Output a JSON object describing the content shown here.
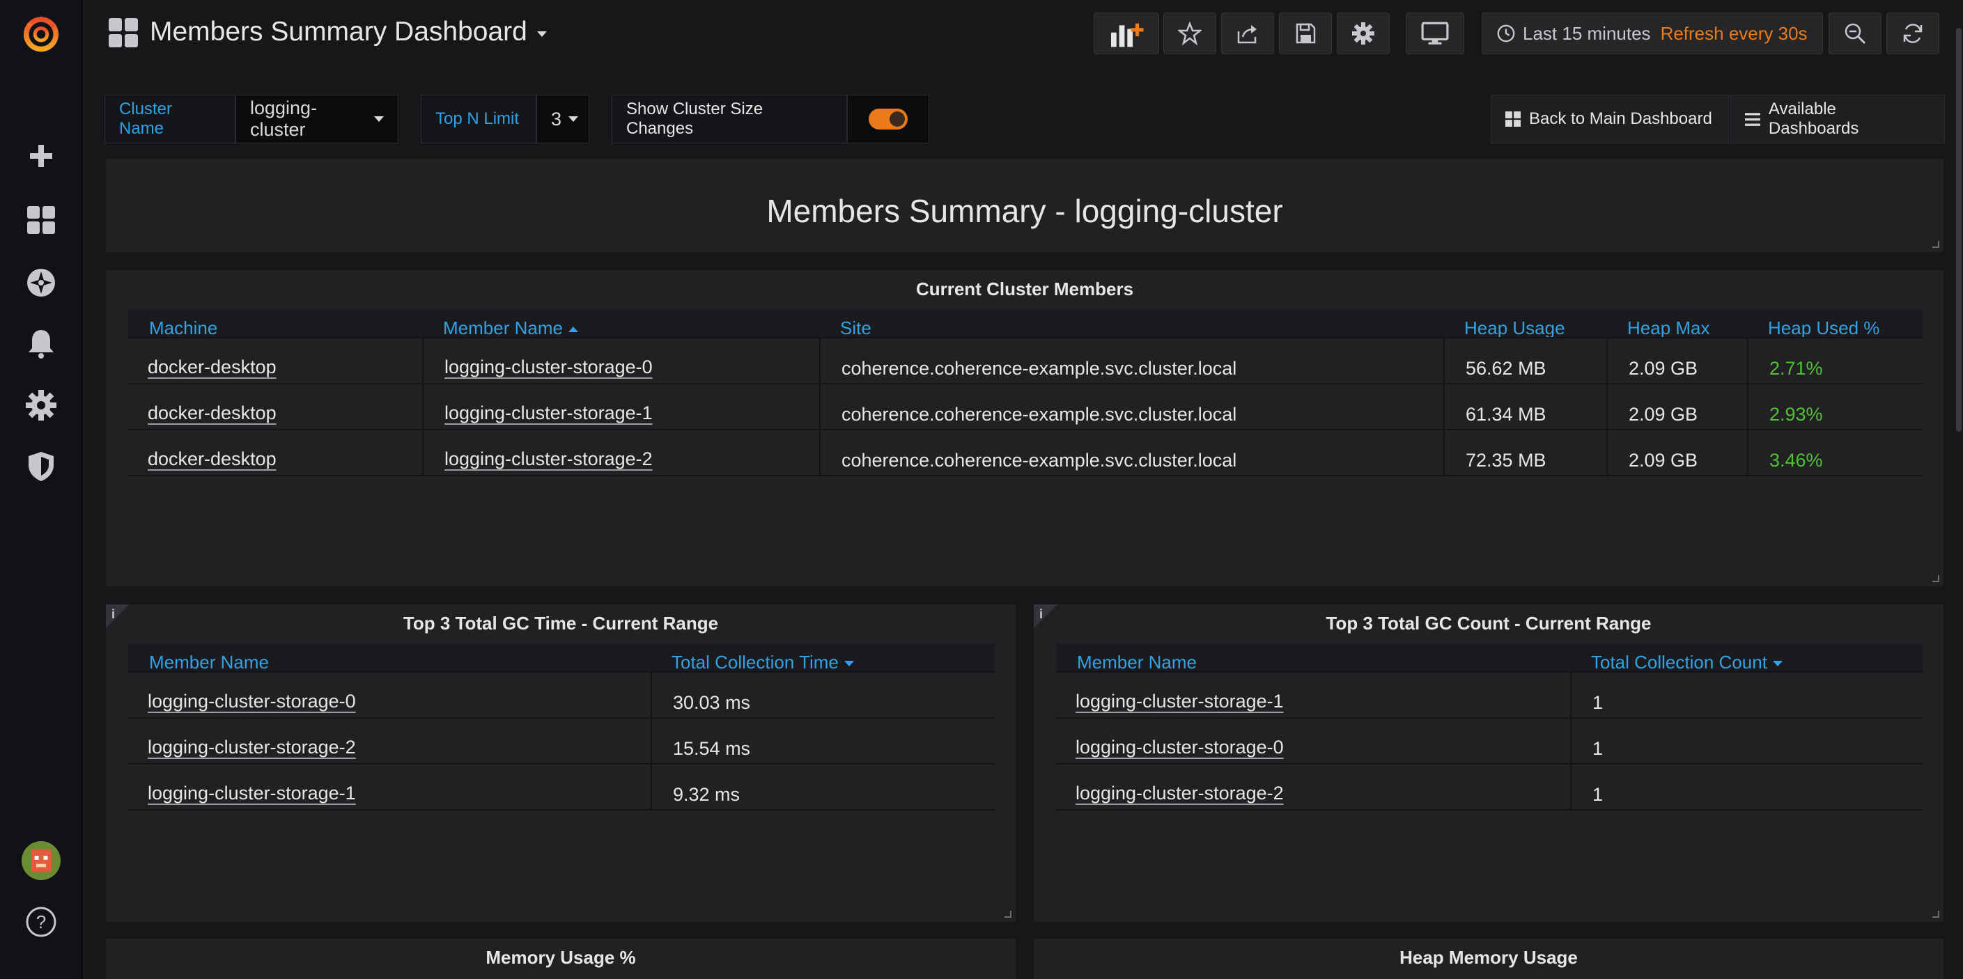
{
  "dashboard": {
    "title": "Members Summary Dashboard"
  },
  "toolbar": {
    "time_range": "Last 15 minutes",
    "refresh": "Refresh every 30s"
  },
  "variables": {
    "cluster_label": "Cluster Name",
    "cluster_value": "logging-cluster",
    "topn_label": "Top N Limit",
    "topn_value": "3",
    "size_changes_label": "Show Cluster Size Changes",
    "size_changes_enabled": true
  },
  "links": {
    "back": "Back to Main Dashboard",
    "available": "Available Dashboards"
  },
  "text_panel": {
    "title": "Members Summary - logging-cluster"
  },
  "members_panel": {
    "title": "Current Cluster Members",
    "columns": [
      "Machine",
      "Member Name",
      "Site",
      "Heap Usage",
      "Heap Max",
      "Heap Used %"
    ],
    "rows": [
      [
        "docker-desktop",
        "logging-cluster-storage-0",
        "coherence.coherence-example.svc.cluster.local",
        "56.62 MB",
        "2.09 GB",
        "2.71%"
      ],
      [
        "docker-desktop",
        "logging-cluster-storage-1",
        "coherence.coherence-example.svc.cluster.local",
        "61.34 MB",
        "2.09 GB",
        "2.93%"
      ],
      [
        "docker-desktop",
        "logging-cluster-storage-2",
        "coherence.coherence-example.svc.cluster.local",
        "72.35 MB",
        "2.09 GB",
        "3.46%"
      ]
    ]
  },
  "gc_time_panel": {
    "info": "i",
    "title": "Top 3 Total GC Time - Current Range",
    "columns": [
      "Member Name",
      "Total Collection Time"
    ],
    "rows": [
      [
        "logging-cluster-storage-0",
        "30.03 ms"
      ],
      [
        "logging-cluster-storage-2",
        "15.54 ms"
      ],
      [
        "logging-cluster-storage-1",
        "9.32 ms"
      ]
    ]
  },
  "gc_count_panel": {
    "info": "i",
    "title": "Top 3 Total GC Count - Current Range",
    "columns": [
      "Member Name",
      "Total Collection Count"
    ],
    "rows": [
      [
        "logging-cluster-storage-1",
        "1"
      ],
      [
        "logging-cluster-storage-0",
        "1"
      ],
      [
        "logging-cluster-storage-2",
        "1"
      ]
    ]
  },
  "memory_usage_panel": {
    "title": "Memory Usage %"
  },
  "heap_memory_panel": {
    "title": "Heap Memory Usage"
  },
  "colors": {
    "accent_orange": "#eb7b18",
    "link_blue": "#33a2e5",
    "ok_green": "#4fc133",
    "panel_bg": "#212124",
    "page_bg": "#161719"
  },
  "icons": {
    "sidebar": [
      "grafana-logo-icon",
      "plus-icon",
      "dashboards-grid-icon",
      "explore-compass-icon",
      "alerting-bell-icon",
      "configuration-gear-icon",
      "server-admin-shield-icon",
      "user-avatar-icon",
      "help-icon"
    ],
    "toolbar": [
      "add-panel-icon",
      "star-icon",
      "share-icon",
      "save-icon",
      "settings-gear-icon",
      "tv-mode-icon",
      "clock-icon",
      "zoom-out-icon",
      "refresh-icon"
    ]
  }
}
